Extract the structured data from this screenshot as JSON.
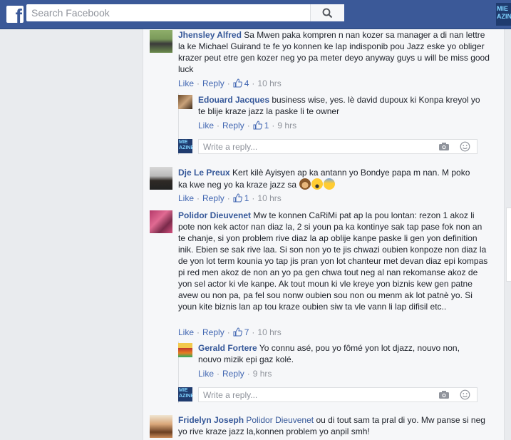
{
  "search": {
    "placeholder": "Search Facebook"
  },
  "corner_thumb_text": "MIE\nAZINE",
  "reply_box": {
    "placeholder": "Write a reply...",
    "avatar_text": "MIE\nAZINE"
  },
  "actions": {
    "like": "Like",
    "reply": "Reply"
  },
  "comments": [
    {
      "author": "Jhensley Alfred",
      "text": "Sa Mwen paka kompren n nan kozer sa manager a di nan lettre la ke Michael Guirand te fe yo konnen ke lap indisponib pou Jazz eske yo obliger krazer peut etre gen kozer neg yo pa meter deyo anyway guys u will be miss good luck",
      "likes": "4",
      "time": "10 hrs",
      "replies": [
        {
          "author": "Edouard Jacques",
          "text": "business wise, yes. lè david dupoux ki Konpa kreyol yo te blije kraze jazz la paske li te owner",
          "likes": "1",
          "time": "9 hrs"
        }
      ]
    },
    {
      "author": "Dje Le Preux",
      "text": "Kert kilè Ayisyen ap ka antann yo Bondye papa m nan. M poko ka kwe neg yo ka kraze jazz sa",
      "likes": "1",
      "time": "10 hrs"
    },
    {
      "author": "Polidor Dieuvenet",
      "text": "Mw te konnen CaRiMi pat ap la pou lontan: rezon 1 akoz li pote non kek actor nan diaz la, 2 si youn pa ka kontinye sak tap pase fok non an te chanje, si yon problem rive diaz la ap oblije kanpe paske li gen yon definition inik. Ebien se sak rive laa. Si son non yo te jis chwazi oubien konpoze non diaz la de yon lot term kounia yo tap jis pran yon lot chanteur met devan diaz epi kompas pi red men akoz de non an yo pa gen chwa tout neg al nan rekomanse akoz de yon sel actor ki vle kanpe. Ak tout moun ki vle kreye yon biznis kew gen patne avew ou non pa, pa fel sou nonw oubien sou non ou menm ak lot patnè yo. Si youn kite biznis lan ap tou kraze oubien siw ta vle vann li lap difisil etc..",
      "likes": "7",
      "time": "10 hrs",
      "replies": [
        {
          "author": "Gerald Fortere",
          "text": "Yo connu asé, pou yo fômé yon lot djazz, nouvo non, nouvo mizik epi gaz kolé.",
          "time": "9 hrs"
        }
      ]
    },
    {
      "author": "Fridelyn Joseph",
      "mention": "Polidor Dieuvenet",
      "text": "ou di tout sam ta pral di yo. Mw panse si neg yo rive kraze jazz la,konnen problem yo anpil smh!"
    }
  ],
  "colors": {
    "topbar": "#3b5998",
    "link": "#365899",
    "action": "#4267b2",
    "meta": "#90949c"
  },
  "icons": [
    "facebook-f-icon",
    "search-icon",
    "like-thumb-icon",
    "camera-icon",
    "smiley-icon",
    "monkey-emoji",
    "screaming-face-emoji",
    "fearful-face-emoji"
  ]
}
